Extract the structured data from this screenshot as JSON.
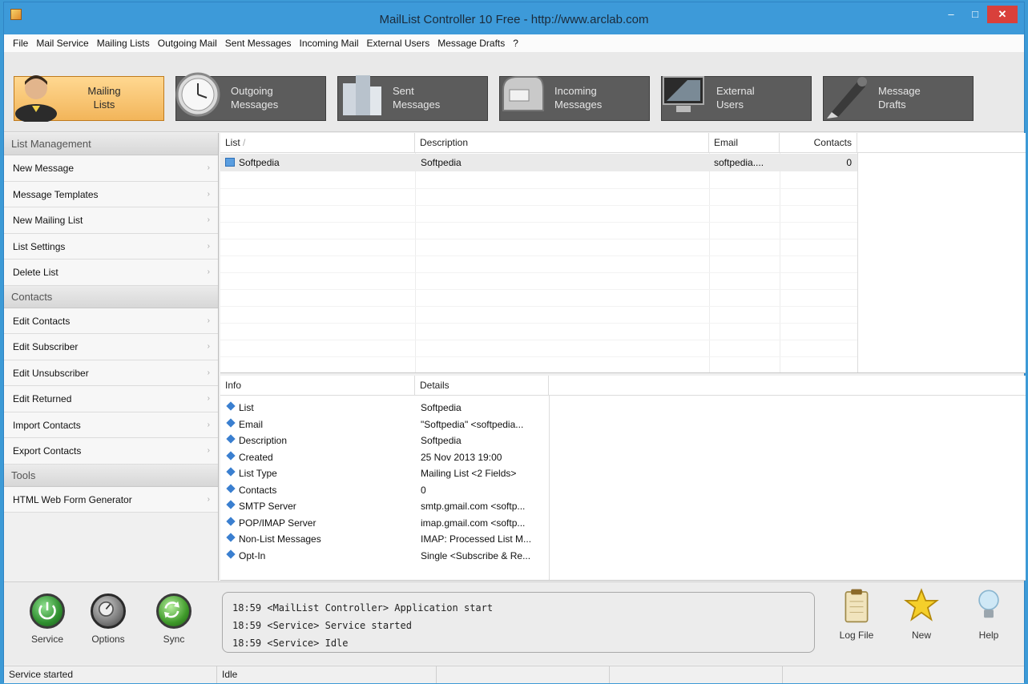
{
  "window": {
    "title": "MailList Controller 10 Free - http://www.arclab.com"
  },
  "menu": [
    "File",
    "Mail Service",
    "Mailing Lists",
    "Outgoing Mail",
    "Sent Messages",
    "Incoming Mail",
    "External Users",
    "Message Drafts",
    "?"
  ],
  "toolbar": [
    {
      "label": "Mailing\nLists",
      "icon": "user-icon",
      "active": true
    },
    {
      "label": "Outgoing\nMessages",
      "icon": "clock-icon",
      "active": false
    },
    {
      "label": "Sent\nMessages",
      "icon": "building-icon",
      "active": false
    },
    {
      "label": "Incoming\nMessages",
      "icon": "mailbox-icon",
      "active": false
    },
    {
      "label": "External\nUsers",
      "icon": "monitor-icon",
      "active": false
    },
    {
      "label": "Message\nDrafts",
      "icon": "pen-icon",
      "active": false
    }
  ],
  "sidebar": {
    "sections": [
      {
        "title": "List Management",
        "items": [
          "New Message",
          "Message Templates",
          "New Mailing List",
          "List Settings",
          "Delete List"
        ]
      },
      {
        "title": "Contacts",
        "items": [
          "Edit Contacts",
          "Edit Subscriber",
          "Edit Unsubscriber",
          "Edit Returned",
          "Import Contacts",
          "Export Contacts"
        ]
      },
      {
        "title": "Tools",
        "items": [
          "HTML Web Form Generator"
        ]
      }
    ]
  },
  "lists_table": {
    "columns": [
      "List",
      "Description",
      "Email",
      "Contacts"
    ],
    "sort_indicator": "/",
    "rows": [
      {
        "list": "Softpedia",
        "description": "Softpedia",
        "email": "softpedia....",
        "contacts": "0"
      }
    ]
  },
  "info_table": {
    "columns": [
      "Info",
      "Details"
    ],
    "rows": [
      {
        "key": "List",
        "value": "Softpedia"
      },
      {
        "key": "Email",
        "value": "\"Softpedia\" <softpedia..."
      },
      {
        "key": "Description",
        "value": "Softpedia"
      },
      {
        "key": "Created",
        "value": "25 Nov 2013 19:00"
      },
      {
        "key": "List Type",
        "value": "Mailing List <2 Fields>"
      },
      {
        "key": "Contacts",
        "value": "0"
      },
      {
        "key": "SMTP Server",
        "value": "smtp.gmail.com <softp..."
      },
      {
        "key": "POP/IMAP Server",
        "value": "imap.gmail.com <softp..."
      },
      {
        "key": "Non-List Messages",
        "value": "IMAP: Processed List M..."
      },
      {
        "key": "Opt-In",
        "value": "Single <Subscribe & Re..."
      }
    ]
  },
  "bottom": {
    "left_buttons": [
      {
        "label": "Service",
        "icon": "power-icon",
        "color": "#2f8f2f"
      },
      {
        "label": "Options",
        "icon": "dial-icon",
        "color": "#5a5a5a"
      },
      {
        "label": "Sync",
        "icon": "sync-icon",
        "color": "#3f9a2a"
      }
    ],
    "log": [
      "18:59 <MailList Controller> Application start",
      "18:59 <Service> Service started",
      "18:59 <Service> Idle"
    ],
    "right_buttons": [
      {
        "label": "Log File",
        "icon": "clipboard-icon"
      },
      {
        "label": "New",
        "icon": "star-icon"
      },
      {
        "label": "Help",
        "icon": "lightbulb-icon"
      }
    ]
  },
  "status": {
    "left": "Service started",
    "right": "Idle"
  }
}
